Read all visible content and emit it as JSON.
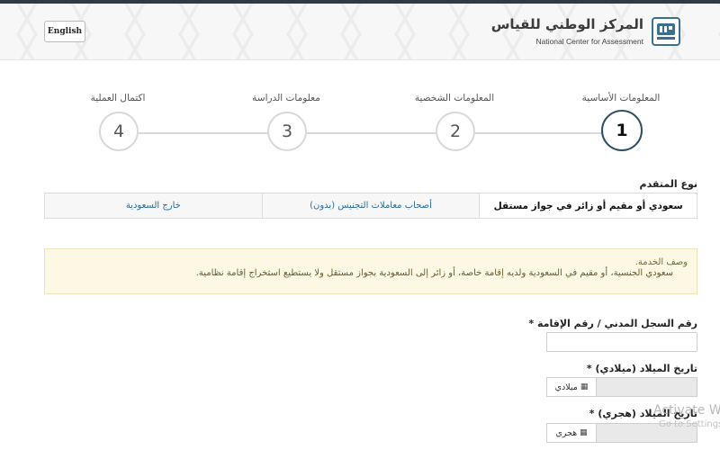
{
  "header": {
    "lang_button": "English",
    "logo_ar": "المركز الوطني للقياس",
    "logo_en": "National Center for Assessment"
  },
  "stepper": {
    "steps": [
      {
        "number": "1",
        "label": "المعلومات الأساسية"
      },
      {
        "number": "2",
        "label": "المعلومات الشخصية"
      },
      {
        "number": "3",
        "label": "معلومات الدراسة"
      },
      {
        "number": "4",
        "label": "اكتمال العملية"
      }
    ],
    "active_step": 1
  },
  "applicant_type": {
    "label": "نوع المتقدم",
    "tabs": [
      "سعودي أو مقيم أو زائر في جواز مستقل",
      "أصحاب معاملات التجنيس (بدون)",
      "خارج السعودية"
    ],
    "selected": 0
  },
  "notice": {
    "title": "وصف الخدمة.",
    "text": "سعودي الجنسية، أو مقيم في السعودية ولديه إقامة خاصة، أو زائر إلى السعودية بجواز مستقل ولا يستطيع استخراج إقامة نظامية."
  },
  "form": {
    "id_label": "رقم السجل المدني / رقم الإقامة *",
    "dob_greg_label": "تاريخ الميلاد (ميلادي) *",
    "dob_greg_addon": "ميلادي",
    "dob_hijri_label": "تاريخ الميلاد (هجري) *",
    "dob_hijri_addon": "هجري"
  },
  "watermark": {
    "line1": "Activate Wir",
    "line2": "Go to Settings t"
  },
  "icons": {
    "calendar": "calendar-icon"
  },
  "colors": {
    "active_step_border": "#2a4f66",
    "tab_link": "#2a6b9c",
    "notice_bg": "#fcf8e3"
  }
}
